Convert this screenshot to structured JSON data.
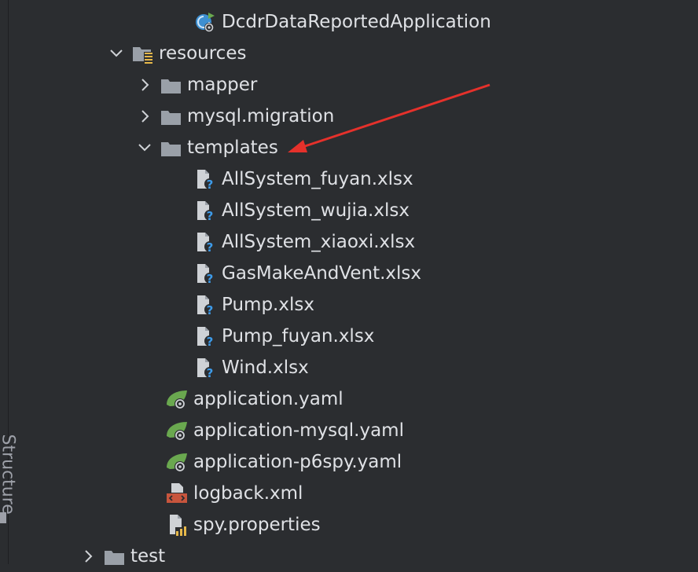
{
  "side_panel": {
    "label": "Structure"
  },
  "tree": {
    "app_class": {
      "label": "DcdrDataReportedApplication",
      "icon": "spring-boot-app-icon"
    },
    "resources": {
      "label": "resources",
      "icon": "resources-folder-icon",
      "expanded": true
    },
    "mapper": {
      "label": "mapper",
      "icon": "folder-icon",
      "expanded": false
    },
    "migration": {
      "label": "mysql.migration",
      "icon": "folder-icon",
      "expanded": false
    },
    "templates": {
      "label": "templates",
      "icon": "folder-icon",
      "expanded": true
    },
    "files": [
      {
        "label": "AllSystem_fuyan.xlsx",
        "icon": "unknown-file-icon"
      },
      {
        "label": "AllSystem_wujia.xlsx",
        "icon": "unknown-file-icon"
      },
      {
        "label": "AllSystem_xiaoxi.xlsx",
        "icon": "unknown-file-icon"
      },
      {
        "label": "GasMakeAndVent.xlsx",
        "icon": "unknown-file-icon"
      },
      {
        "label": "Pump.xlsx",
        "icon": "unknown-file-icon"
      },
      {
        "label": "Pump_fuyan.xlsx",
        "icon": "unknown-file-icon"
      },
      {
        "label": "Wind.xlsx",
        "icon": "unknown-file-icon"
      }
    ],
    "configs": [
      {
        "label": "application.yaml",
        "icon": "spring-config-icon"
      },
      {
        "label": "application-mysql.yaml",
        "icon": "spring-config-icon"
      },
      {
        "label": "application-p6spy.yaml",
        "icon": "spring-config-icon"
      }
    ],
    "logback": {
      "label": "logback.xml",
      "icon": "xml-file-icon"
    },
    "spy": {
      "label": "spy.properties",
      "icon": "properties-file-icon"
    },
    "test": {
      "label": "test",
      "icon": "folder-icon",
      "expanded": false
    }
  },
  "colors": {
    "background": "#2b2d30",
    "text": "#dfe1e5",
    "folder": "#9aa0a8",
    "annotation_arrow": "#e5312b",
    "spring_green": "#6aa84f",
    "help_blue": "#3d9be9"
  }
}
